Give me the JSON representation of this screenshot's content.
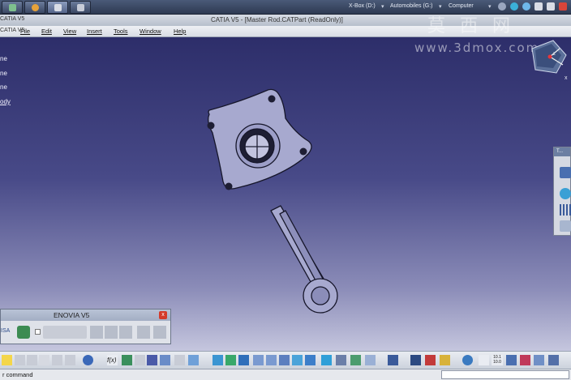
{
  "taskbar": {
    "drives": [
      "X-Box (D:)",
      "Automobiles (G:)",
      "Computer"
    ],
    "dropdown_glyph": "▾"
  },
  "window": {
    "app_title": "CATIA V5",
    "doc_title": "CATIA V5 - [Master Rod.CATPart (ReadOnly)]"
  },
  "menu": {
    "items": [
      {
        "label": "File"
      },
      {
        "label": "Edit"
      },
      {
        "label": "View"
      },
      {
        "label": "Insert"
      },
      {
        "label": "Tools"
      },
      {
        "label": "Window"
      },
      {
        "label": "Help"
      }
    ]
  },
  "watermark": {
    "chinese": "莫西网",
    "url": "www.3dmox.com"
  },
  "tree": {
    "items": [
      "ne",
      "ne",
      "ne",
      "ody"
    ]
  },
  "compass": {
    "axis_x": "x",
    "axis_z": "z"
  },
  "tools_panel": {
    "title": "T..."
  },
  "enovia": {
    "title": "ENOVIA V5",
    "close_glyph": "x",
    "vendor_text": "ISA"
  },
  "bottom_toolbar": {
    "scale_top": "10.1",
    "scale_bottom": "10.0"
  },
  "status": {
    "command_label": "r command"
  },
  "colors": {
    "part_fill": "#a7a9cf",
    "part_edge": "#16162a",
    "bolt_hole": "#1e1e34",
    "viewport_top": "#2d2e6a",
    "viewport_bottom": "#c5c6de"
  }
}
